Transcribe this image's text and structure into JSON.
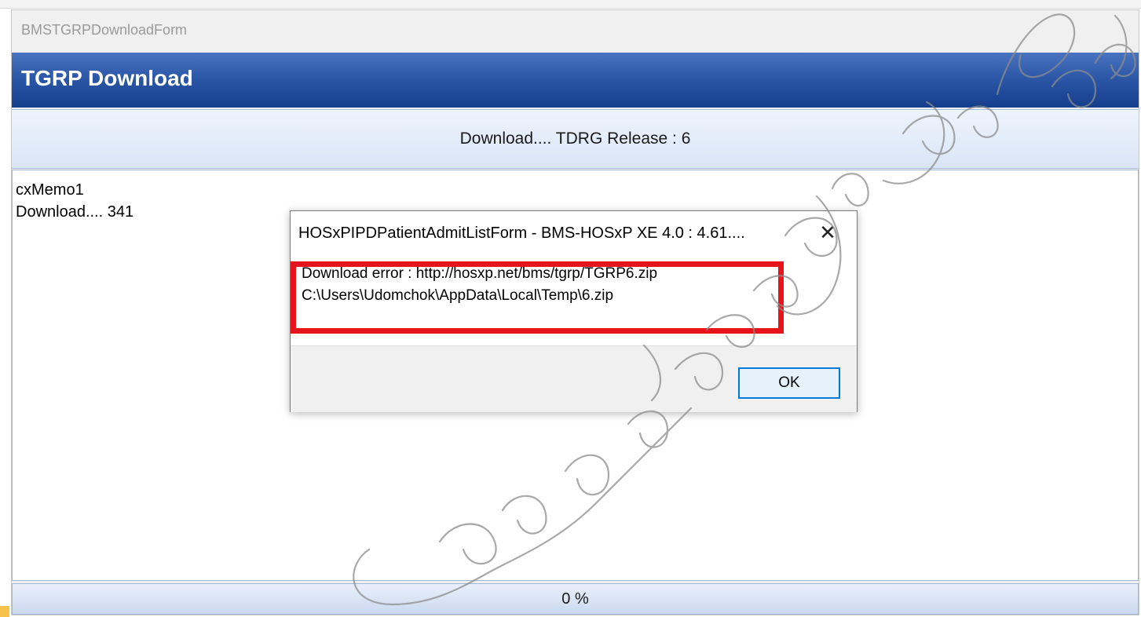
{
  "background_window": {
    "form_name": "BMSTGRPDownloadForm",
    "header_title": "TGRP Download",
    "status_text": "Download.... TDRG Release : 6",
    "memo_lines": [
      "cxMemo1",
      "Download.... 341"
    ],
    "progress": {
      "label": "0 %",
      "percent": 0
    }
  },
  "dialog": {
    "title": "HOSxPIPDPatientAdmitListForm - BMS-HOSxP XE 4.0 : 4.61....",
    "close_glyph": "✕",
    "message_lines": [
      "Download error : http://hosxp.net/bms/tgrp/TGRP6.zip",
      "C:\\Users\\Udomchok\\AppData\\Local\\Temp\\6.zip"
    ],
    "ok_label": "OK"
  },
  "highlight": {
    "color": "#e8141b"
  },
  "colors": {
    "banner": "#2d58a8",
    "status_panel": "#dde8f7",
    "ok_border": "#0078d7"
  },
  "icons": {
    "close": "close-icon"
  }
}
